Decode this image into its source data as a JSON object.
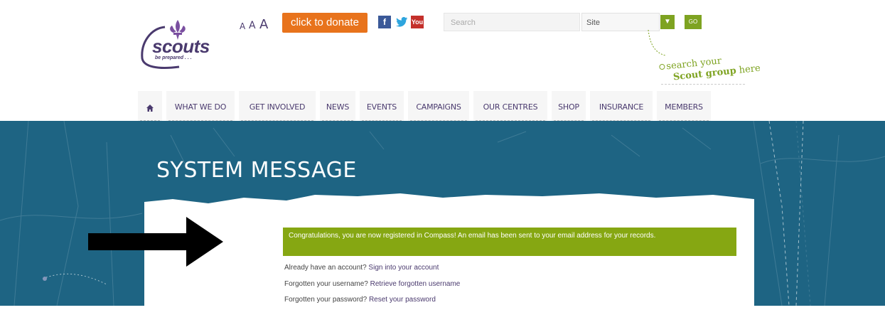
{
  "logo": {
    "wordmark": "scouts",
    "tagline": "be prepared . . ."
  },
  "text_size": {
    "small": "A",
    "medium": "A",
    "large": "A"
  },
  "donate_label": "click to donate",
  "social": {
    "facebook": "f",
    "twitter": "🐦",
    "youtube": "You"
  },
  "search": {
    "placeholder": "Search",
    "scope": "Site",
    "go_label": "GO"
  },
  "group_hint": {
    "line1": "search your",
    "line2a": "Scout group",
    "line2b": " here"
  },
  "nav": [
    {
      "label": "WHAT WE DO"
    },
    {
      "label": "GET INVOLVED"
    },
    {
      "label": "NEWS"
    },
    {
      "label": "EVENTS"
    },
    {
      "label": "CAMPAIGNS"
    },
    {
      "label": "OUR CENTRES"
    },
    {
      "label": "SHOP"
    },
    {
      "label": "INSURANCE"
    },
    {
      "label": "MEMBERS"
    }
  ],
  "page_title": "SYSTEM MESSAGE",
  "alert": "Congratulations, you are now registered in Compass! An email has been sent to your email address for your records.",
  "links": [
    {
      "prefix": "Already have an account? ",
      "link": "Sign into your account"
    },
    {
      "prefix": "Forgotten your username? ",
      "link": "Retrieve forgotten username"
    },
    {
      "prefix": "Forgotten your password? ",
      "link": "Reset your password"
    }
  ],
  "colors": {
    "brand_purple": "#4a3a6e",
    "accent_green": "#86a712",
    "banner_blue": "#1e6483",
    "donate_orange": "#e8731c"
  }
}
